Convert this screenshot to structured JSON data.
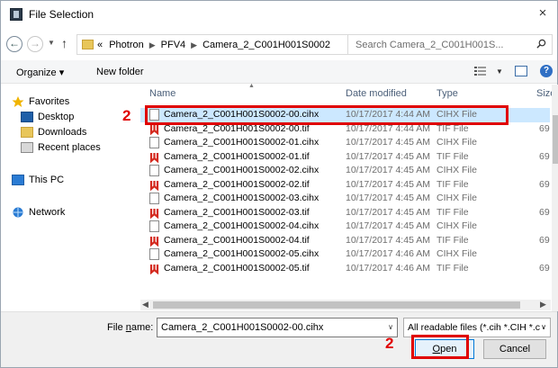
{
  "window": {
    "title": "File Selection",
    "close_glyph": "×"
  },
  "address": {
    "breadcrumbs": [
      "«",
      "Photron",
      "PFV4",
      "Camera_2_C001H001S0002"
    ],
    "search_placeholder": "Search Camera_2_C001H001S..."
  },
  "commands": {
    "organize": "Organize ▾",
    "new_folder": "New folder"
  },
  "nav": {
    "items": [
      {
        "label": "Favorites",
        "icon": "star-icon"
      },
      {
        "label": "Desktop",
        "icon": "desktop-icon"
      },
      {
        "label": "Downloads",
        "icon": "downloads-icon"
      },
      {
        "label": "Recent places",
        "icon": "recent-places-icon"
      },
      {
        "label": "This PC",
        "icon": "this-pc-icon"
      },
      {
        "label": "Network",
        "icon": "network-icon"
      }
    ]
  },
  "columns": {
    "name": "Name",
    "date": "Date modified",
    "type": "Type",
    "size": "Size"
  },
  "files": [
    {
      "name": "Camera_2_C001H001S0002-00.cihx",
      "date": "10/17/2017 4:44 AM",
      "type": "CIHX File",
      "size": "",
      "kind": "cihx"
    },
    {
      "name": "Camera_2_C001H001S0002-00.tif",
      "date": "10/17/2017 4:44 AM",
      "type": "TIF File",
      "size": "69",
      "kind": "tif"
    },
    {
      "name": "Camera_2_C001H001S0002-01.cihx",
      "date": "10/17/2017 4:45 AM",
      "type": "CIHX File",
      "size": "",
      "kind": "cihx"
    },
    {
      "name": "Camera_2_C001H001S0002-01.tif",
      "date": "10/17/2017 4:45 AM",
      "type": "TIF File",
      "size": "69",
      "kind": "tif"
    },
    {
      "name": "Camera_2_C001H001S0002-02.cihx",
      "date": "10/17/2017 4:45 AM",
      "type": "CIHX File",
      "size": "",
      "kind": "cihx"
    },
    {
      "name": "Camera_2_C001H001S0002-02.tif",
      "date": "10/17/2017 4:45 AM",
      "type": "TIF File",
      "size": "69",
      "kind": "tif"
    },
    {
      "name": "Camera_2_C001H001S0002-03.cihx",
      "date": "10/17/2017 4:45 AM",
      "type": "CIHX File",
      "size": "",
      "kind": "cihx"
    },
    {
      "name": "Camera_2_C001H001S0002-03.tif",
      "date": "10/17/2017 4:45 AM",
      "type": "TIF File",
      "size": "69",
      "kind": "tif"
    },
    {
      "name": "Camera_2_C001H001S0002-04.cihx",
      "date": "10/17/2017 4:45 AM",
      "type": "CIHX File",
      "size": "",
      "kind": "cihx"
    },
    {
      "name": "Camera_2_C001H001S0002-04.tif",
      "date": "10/17/2017 4:45 AM",
      "type": "TIF File",
      "size": "69",
      "kind": "tif"
    },
    {
      "name": "Camera_2_C001H001S0002-05.cihx",
      "date": "10/17/2017 4:46 AM",
      "type": "CIHX File",
      "size": "",
      "kind": "cihx"
    },
    {
      "name": "Camera_2_C001H001S0002-05.tif",
      "date": "10/17/2017 4:46 AM",
      "type": "TIF File",
      "size": "69",
      "kind": "tif"
    }
  ],
  "footer": {
    "file_name_label_prefix": "File ",
    "file_name_label_ul": "n",
    "file_name_label_suffix": "ame:",
    "file_name_value": "Camera_2_C001H001S0002-00.cihx",
    "filter": "All readable files (*.cih *.CIH *.c",
    "open_ul": "O",
    "open_rest": "pen",
    "cancel": "Cancel"
  },
  "annotations": {
    "step_file": "2",
    "step_open": "2",
    "color": "#e00000"
  }
}
